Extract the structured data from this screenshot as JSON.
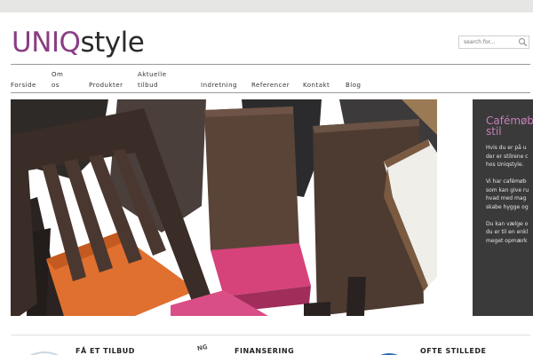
{
  "logo": {
    "part1": "UNIQ",
    "part2": "style"
  },
  "search": {
    "placeholder": "search for..."
  },
  "nav": {
    "forside": "Forside",
    "om_1": "Om",
    "om_2": "os",
    "produkter": "Produkter",
    "tilbud_1": "Aktuelle",
    "tilbud_2": "tilbud",
    "indretning": "Indretning",
    "referencer": "Referencer",
    "kontakt": "Kontakt",
    "blog": "Blog"
  },
  "hero": {
    "image": "stacked-wooden-chairs-with-pink-and-orange-seats"
  },
  "side_panel": {
    "title_1": "Cafémøbl",
    "title_2": "stil",
    "lines": [
      "Hvis du er på u",
      "der er stilrene c",
      "hos Uniqstyle.",
      "",
      "Vi har cafémøb",
      "som kan give ru",
      "hvad med mag",
      "skabe hygge og",
      "",
      "Du kan vælge o",
      "du er til en enkl",
      "meget opmærk"
    ]
  },
  "bottom": {
    "item1": "FÅ ET TILBUD",
    "item2": "FINANSERING",
    "item3": "OFTE STILLEDE",
    "item2_icon_text": "NG"
  },
  "colors": {
    "brand_purple": "#8a3d83",
    "side_bg": "#3a3a3a",
    "side_title": "#c77fba"
  }
}
